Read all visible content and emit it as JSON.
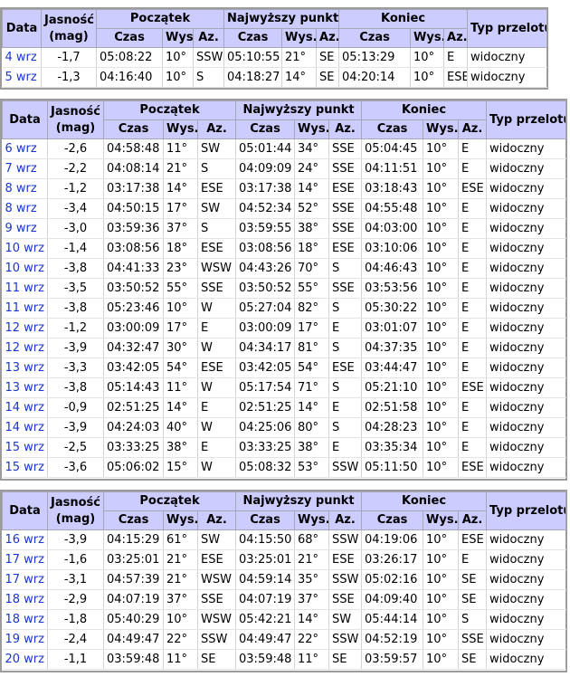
{
  "headers": {
    "date": "Data",
    "magnitude_1": "Jasność",
    "magnitude_2": "(mag)",
    "start": "Początek",
    "peak": "Najwyższy punkt",
    "end": "Koniec",
    "pass_type": "Typ przelotu",
    "time": "Czas",
    "altitude": "Wys.",
    "azimuth": "Az."
  },
  "tables": [
    {
      "rows": [
        {
          "date": "4 wrz",
          "mag": "-1,7",
          "start_time": "05:08:22",
          "start_alt": "10°",
          "start_az": "SSW",
          "peak_time": "05:10:55",
          "peak_alt": "21°",
          "peak_az": "SE",
          "end_time": "05:13:29",
          "end_alt": "10°",
          "end_az": "E",
          "type": "widoczny"
        },
        {
          "date": "5 wrz",
          "mag": "-1,3",
          "start_time": "04:16:40",
          "start_alt": "10°",
          "start_az": "S",
          "peak_time": "04:18:27",
          "peak_alt": "14°",
          "peak_az": "SE",
          "end_time": "04:20:14",
          "end_alt": "10°",
          "end_az": "ESE",
          "type": "widoczny"
        }
      ]
    },
    {
      "rows": [
        {
          "date": "6 wrz",
          "mag": "-2,6",
          "start_time": "04:58:48",
          "start_alt": "11°",
          "start_az": "SW",
          "peak_time": "05:01:44",
          "peak_alt": "34°",
          "peak_az": "SSE",
          "end_time": "05:04:45",
          "end_alt": "10°",
          "end_az": "E",
          "type": "widoczny"
        },
        {
          "date": "7 wrz",
          "mag": "-2,2",
          "start_time": "04:08:14",
          "start_alt": "21°",
          "start_az": "S",
          "peak_time": "04:09:09",
          "peak_alt": "24°",
          "peak_az": "SSE",
          "end_time": "04:11:51",
          "end_alt": "10°",
          "end_az": "E",
          "type": "widoczny"
        },
        {
          "date": "8 wrz",
          "mag": "-1,2",
          "start_time": "03:17:38",
          "start_alt": "14°",
          "start_az": "ESE",
          "peak_time": "03:17:38",
          "peak_alt": "14°",
          "peak_az": "ESE",
          "end_time": "03:18:43",
          "end_alt": "10°",
          "end_az": "ESE",
          "type": "widoczny"
        },
        {
          "date": "8 wrz",
          "mag": "-3,4",
          "start_time": "04:50:15",
          "start_alt": "17°",
          "start_az": "SW",
          "peak_time": "04:52:34",
          "peak_alt": "52°",
          "peak_az": "SSE",
          "end_time": "04:55:48",
          "end_alt": "10°",
          "end_az": "E",
          "type": "widoczny"
        },
        {
          "date": "9 wrz",
          "mag": "-3,0",
          "start_time": "03:59:36",
          "start_alt": "37°",
          "start_az": "S",
          "peak_time": "03:59:55",
          "peak_alt": "38°",
          "peak_az": "SSE",
          "end_time": "04:03:00",
          "end_alt": "10°",
          "end_az": "E",
          "type": "widoczny"
        },
        {
          "date": "10 wrz",
          "mag": "-1,4",
          "start_time": "03:08:56",
          "start_alt": "18°",
          "start_az": "ESE",
          "peak_time": "03:08:56",
          "peak_alt": "18°",
          "peak_az": "ESE",
          "end_time": "03:10:06",
          "end_alt": "10°",
          "end_az": "E",
          "type": "widoczny"
        },
        {
          "date": "10 wrz",
          "mag": "-3,8",
          "start_time": "04:41:33",
          "start_alt": "23°",
          "start_az": "WSW",
          "peak_time": "04:43:26",
          "peak_alt": "70°",
          "peak_az": "S",
          "end_time": "04:46:43",
          "end_alt": "10°",
          "end_az": "E",
          "type": "widoczny"
        },
        {
          "date": "11 wrz",
          "mag": "-3,5",
          "start_time": "03:50:52",
          "start_alt": "55°",
          "start_az": "SSE",
          "peak_time": "03:50:52",
          "peak_alt": "55°",
          "peak_az": "SSE",
          "end_time": "03:53:56",
          "end_alt": "10°",
          "end_az": "E",
          "type": "widoczny"
        },
        {
          "date": "11 wrz",
          "mag": "-3,8",
          "start_time": "05:23:46",
          "start_alt": "10°",
          "start_az": "W",
          "peak_time": "05:27:04",
          "peak_alt": "82°",
          "peak_az": "S",
          "end_time": "05:30:22",
          "end_alt": "10°",
          "end_az": "E",
          "type": "widoczny"
        },
        {
          "date": "12 wrz",
          "mag": "-1,2",
          "start_time": "03:00:09",
          "start_alt": "17°",
          "start_az": "E",
          "peak_time": "03:00:09",
          "peak_alt": "17°",
          "peak_az": "E",
          "end_time": "03:01:07",
          "end_alt": "10°",
          "end_az": "E",
          "type": "widoczny"
        },
        {
          "date": "12 wrz",
          "mag": "-3,9",
          "start_time": "04:32:47",
          "start_alt": "30°",
          "start_az": "W",
          "peak_time": "04:34:17",
          "peak_alt": "81°",
          "peak_az": "S",
          "end_time": "04:37:35",
          "end_alt": "10°",
          "end_az": "E",
          "type": "widoczny"
        },
        {
          "date": "13 wrz",
          "mag": "-3,3",
          "start_time": "03:42:05",
          "start_alt": "54°",
          "start_az": "ESE",
          "peak_time": "03:42:05",
          "peak_alt": "54°",
          "peak_az": "ESE",
          "end_time": "03:44:47",
          "end_alt": "10°",
          "end_az": "E",
          "type": "widoczny"
        },
        {
          "date": "13 wrz",
          "mag": "-3,8",
          "start_time": "05:14:43",
          "start_alt": "11°",
          "start_az": "W",
          "peak_time": "05:17:54",
          "peak_alt": "71°",
          "peak_az": "S",
          "end_time": "05:21:10",
          "end_alt": "10°",
          "end_az": "ESE",
          "type": "widoczny"
        },
        {
          "date": "14 wrz",
          "mag": "-0,9",
          "start_time": "02:51:25",
          "start_alt": "14°",
          "start_az": "E",
          "peak_time": "02:51:25",
          "peak_alt": "14°",
          "peak_az": "E",
          "end_time": "02:51:58",
          "end_alt": "10°",
          "end_az": "E",
          "type": "widoczny"
        },
        {
          "date": "14 wrz",
          "mag": "-3,9",
          "start_time": "04:24:03",
          "start_alt": "40°",
          "start_az": "W",
          "peak_time": "04:25:06",
          "peak_alt": "80°",
          "peak_az": "S",
          "end_time": "04:28:23",
          "end_alt": "10°",
          "end_az": "E",
          "type": "widoczny"
        },
        {
          "date": "15 wrz",
          "mag": "-2,5",
          "start_time": "03:33:25",
          "start_alt": "38°",
          "start_az": "E",
          "peak_time": "03:33:25",
          "peak_alt": "38°",
          "peak_az": "E",
          "end_time": "03:35:34",
          "end_alt": "10°",
          "end_az": "E",
          "type": "widoczny"
        },
        {
          "date": "15 wrz",
          "mag": "-3,6",
          "start_time": "05:06:02",
          "start_alt": "15°",
          "start_az": "W",
          "peak_time": "05:08:32",
          "peak_alt": "53°",
          "peak_az": "SSW",
          "end_time": "05:11:50",
          "end_alt": "10°",
          "end_az": "ESE",
          "type": "widoczny"
        }
      ]
    },
    {
      "rows": [
        {
          "date": "16 wrz",
          "mag": "-3,9",
          "start_time": "04:15:29",
          "start_alt": "61°",
          "start_az": "SW",
          "peak_time": "04:15:50",
          "peak_alt": "68°",
          "peak_az": "SSW",
          "end_time": "04:19:06",
          "end_alt": "10°",
          "end_az": "ESE",
          "type": "widoczny"
        },
        {
          "date": "17 wrz",
          "mag": "-1,6",
          "start_time": "03:25:01",
          "start_alt": "21°",
          "start_az": "ESE",
          "peak_time": "03:25:01",
          "peak_alt": "21°",
          "peak_az": "ESE",
          "end_time": "03:26:17",
          "end_alt": "10°",
          "end_az": "E",
          "type": "widoczny"
        },
        {
          "date": "17 wrz",
          "mag": "-3,1",
          "start_time": "04:57:39",
          "start_alt": "21°",
          "start_az": "WSW",
          "peak_time": "04:59:14",
          "peak_alt": "35°",
          "peak_az": "SSW",
          "end_time": "05:02:16",
          "end_alt": "10°",
          "end_az": "SE",
          "type": "widoczny"
        },
        {
          "date": "18 wrz",
          "mag": "-2,9",
          "start_time": "04:07:19",
          "start_alt": "37°",
          "start_az": "SSE",
          "peak_time": "04:07:19",
          "peak_alt": "37°",
          "peak_az": "SSE",
          "end_time": "04:09:40",
          "end_alt": "10°",
          "end_az": "SE",
          "type": "widoczny"
        },
        {
          "date": "18 wrz",
          "mag": "-1,8",
          "start_time": "05:40:29",
          "start_alt": "10°",
          "start_az": "WSW",
          "peak_time": "05:42:21",
          "peak_alt": "14°",
          "peak_az": "SW",
          "end_time": "05:44:14",
          "end_alt": "10°",
          "end_az": "S",
          "type": "widoczny"
        },
        {
          "date": "19 wrz",
          "mag": "-2,4",
          "start_time": "04:49:47",
          "start_alt": "22°",
          "start_az": "SSW",
          "peak_time": "04:49:47",
          "peak_alt": "22°",
          "peak_az": "SSW",
          "end_time": "04:52:19",
          "end_alt": "10°",
          "end_az": "SSE",
          "type": "widoczny"
        },
        {
          "date": "20 wrz",
          "mag": "-1,1",
          "start_time": "03:59:48",
          "start_alt": "11°",
          "start_az": "SE",
          "peak_time": "03:59:48",
          "peak_alt": "11°",
          "peak_az": "SE",
          "end_time": "03:59:57",
          "end_alt": "10°",
          "end_az": "SE",
          "type": "widoczny"
        }
      ]
    }
  ]
}
